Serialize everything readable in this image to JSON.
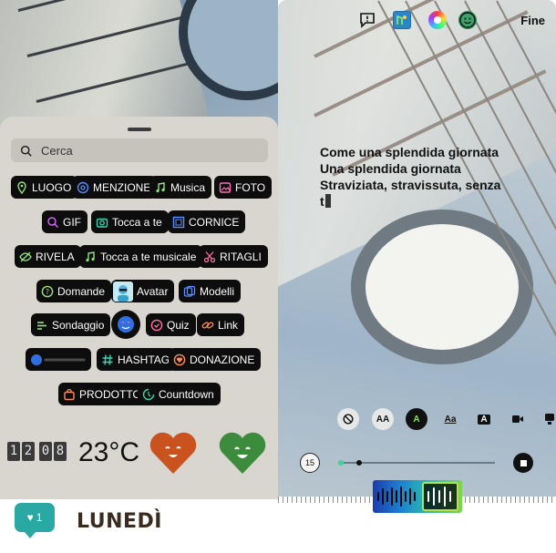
{
  "left": {
    "search_placeholder": "Cerca",
    "stickers": [
      {
        "label": "LUOGO",
        "icon": "location-pin-icon",
        "color": "#9fe27a"
      },
      {
        "label": "MENZIONE",
        "icon": "at-sign-icon",
        "color": "#5b8dff"
      },
      {
        "label": "Musica",
        "icon": "music-note-icon",
        "color": "#8fe37a"
      },
      {
        "label": "FOTO",
        "icon": "photo-icon",
        "color": "#ff6fb3"
      },
      {
        "label": "GIF",
        "icon": "gif-search-icon",
        "color": "#d767ff"
      },
      {
        "label": "Tocca a te",
        "icon": "camera-icon",
        "color": "#35d6b0"
      },
      {
        "label": "CORNICE",
        "icon": "frame-icon",
        "color": "#5b8dff"
      },
      {
        "label": "RIVELA",
        "icon": "eye-off-icon",
        "color": "#8fe37a"
      },
      {
        "label": "Tocca a te musicale",
        "icon": "music-note-icon",
        "color": "#8fe37a"
      },
      {
        "label": "RITAGLI",
        "icon": "scissors-icon",
        "color": "#ff6fa0"
      },
      {
        "label": "Domande",
        "icon": "question-icon",
        "color": "#9fe27a"
      },
      {
        "label": "Avatar",
        "icon": "avatar-icon",
        "color": "#4fb6e0"
      },
      {
        "label": "Modelli",
        "icon": "templates-icon",
        "color": "#5b8dff"
      },
      {
        "label": "Sondaggio",
        "icon": "poll-icon",
        "color": "#8fe37a"
      },
      {
        "label": "Quiz",
        "icon": "check-circle-icon",
        "color": "#ff6fa0"
      },
      {
        "label": "Link",
        "icon": "link-icon",
        "color": "#ff8c5a"
      },
      {
        "label": "HASHTAG",
        "icon": "hashtag-icon",
        "color": "#35d6b0"
      },
      {
        "label": "DONAZIONE",
        "icon": "donation-heart-icon",
        "color": "#ff8c5a"
      },
      {
        "label": "PRODOTTO",
        "icon": "shopping-bag-icon",
        "color": "#ff8c5a"
      },
      {
        "label": "Countdown",
        "icon": "countdown-icon",
        "color": "#35d6b0"
      }
    ],
    "flip_clock": [
      "1",
      "2",
      "0",
      "8"
    ],
    "temperature": "23°C",
    "like_count": "1",
    "day_label": "LUNEDÌ"
  },
  "right": {
    "done_label": "Fine",
    "caption_lines": [
      "Come una splendida giornata",
      "Una splendida giornata",
      "Straviziata, stravissuta, senza",
      "t"
    ],
    "toolbar": [
      {
        "icon": "no-effect-icon",
        "label": ""
      },
      {
        "icon": "font-size-icon",
        "label": "AA"
      },
      {
        "icon": "lyrics-style-icon",
        "label": "A"
      },
      {
        "icon": "text-style-icon",
        "label": "Aa"
      },
      {
        "icon": "text-background-icon",
        "label": "A"
      },
      {
        "icon": "video-camera-icon",
        "label": ""
      },
      {
        "icon": "stack-icon",
        "label": ""
      }
    ],
    "timer_label": "15",
    "accent": "#8ce36d"
  }
}
